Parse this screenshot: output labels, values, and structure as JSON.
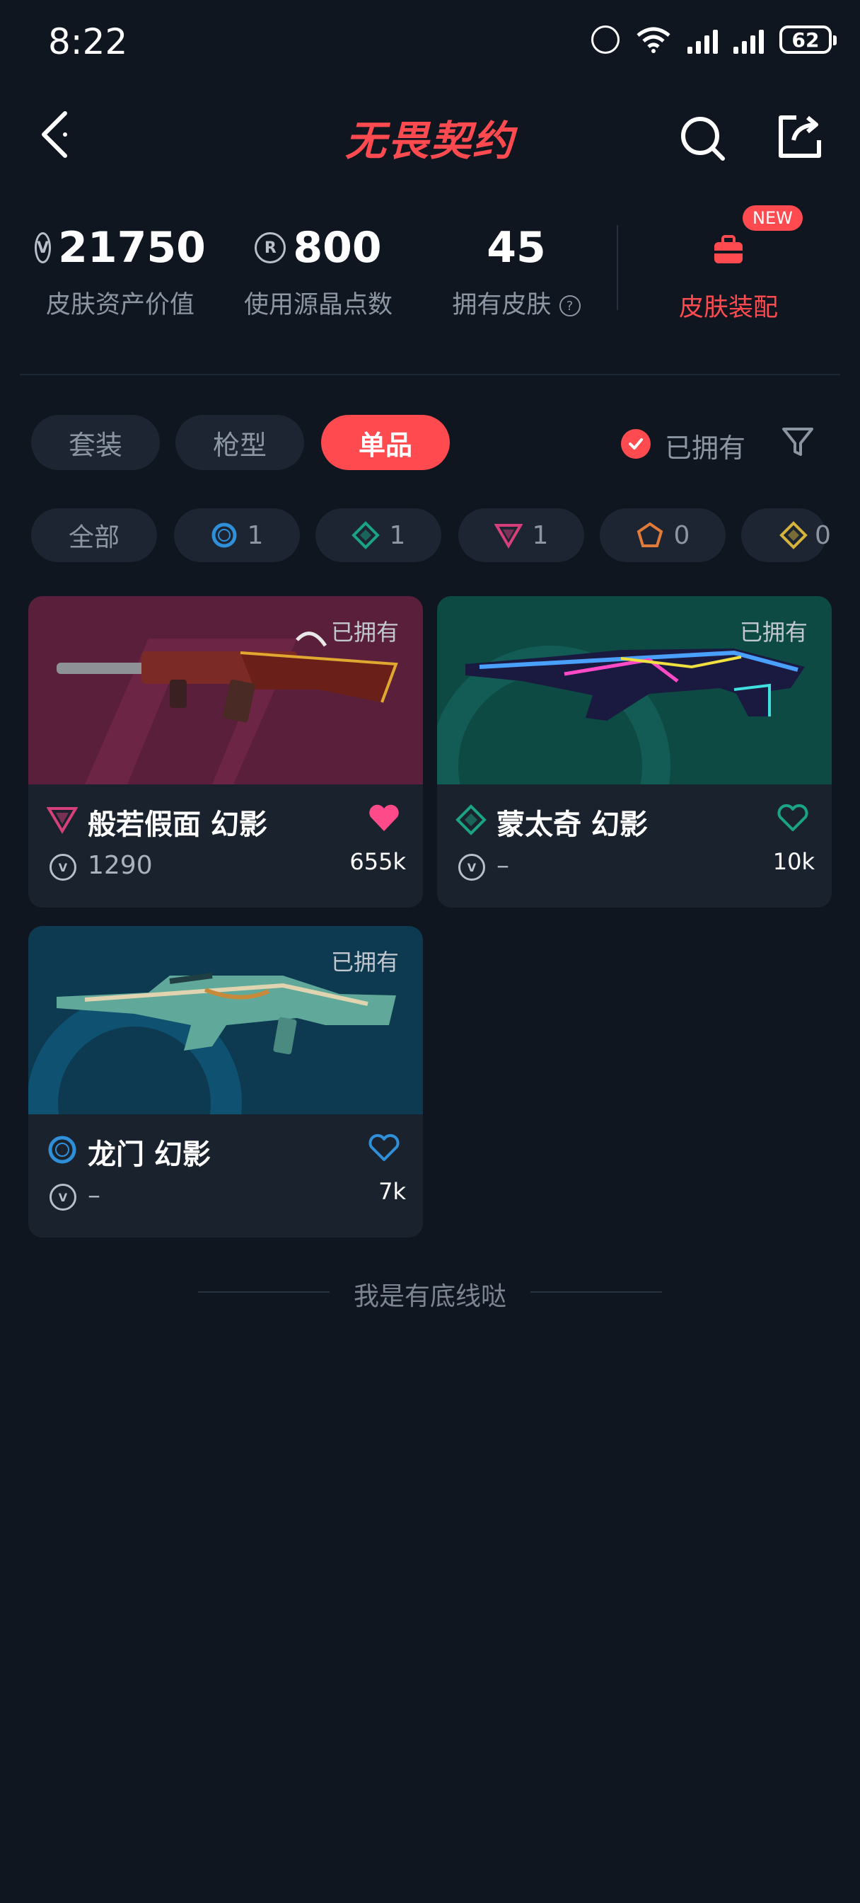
{
  "status_bar": {
    "time": "8:22",
    "battery": "62"
  },
  "header": {
    "title": "无畏契约"
  },
  "stats": [
    {
      "value": "21750",
      "label": "皮肤资产价值",
      "icon": "vp-coin-icon"
    },
    {
      "value": "800",
      "label": "使用源晶点数",
      "icon": "radianite-icon"
    },
    {
      "value": "45",
      "label": "拥有皮肤",
      "icon": "help-icon"
    }
  ],
  "loadout": {
    "badge": "NEW",
    "label": "皮肤装配"
  },
  "tabs": [
    {
      "label": "套装",
      "active": false
    },
    {
      "label": "枪型",
      "active": false
    },
    {
      "label": "单品",
      "active": true
    }
  ],
  "owned_filter": {
    "label": "已拥有",
    "checked": true
  },
  "rarity_chips": [
    {
      "label": "全部"
    },
    {
      "count": "1",
      "color": "#2f8fd8",
      "icon": "circle-tier-icon"
    },
    {
      "count": "1",
      "color": "#1aa385",
      "icon": "diamond-tier-icon"
    },
    {
      "count": "1",
      "color": "#d6407a",
      "icon": "triangle-tier-icon"
    },
    {
      "count": "0",
      "color": "#e07b3a",
      "icon": "pentagon-tier-icon"
    },
    {
      "count": "0",
      "color": "#d6b43c",
      "icon": "square-tier-icon"
    }
  ],
  "cards": [
    {
      "owned": "已拥有",
      "name": "般若假面 幻影",
      "price": "1290",
      "likes": "655k",
      "liked": true,
      "tier_color": "#d6407a",
      "bg": "#6a2040"
    },
    {
      "owned": "已拥有",
      "name": "蒙太奇 幻影",
      "price": "–",
      "likes": "10k",
      "liked": false,
      "tier_color": "#1aa385",
      "bg": "#0f4a44"
    },
    {
      "owned": "已拥有",
      "name": "龙门 幻影",
      "price": "–",
      "likes": "7k",
      "liked": false,
      "tier_color": "#2f8fd8",
      "bg": "#0f3a52"
    }
  ],
  "footer": {
    "end_text": "我是有底线哒"
  }
}
